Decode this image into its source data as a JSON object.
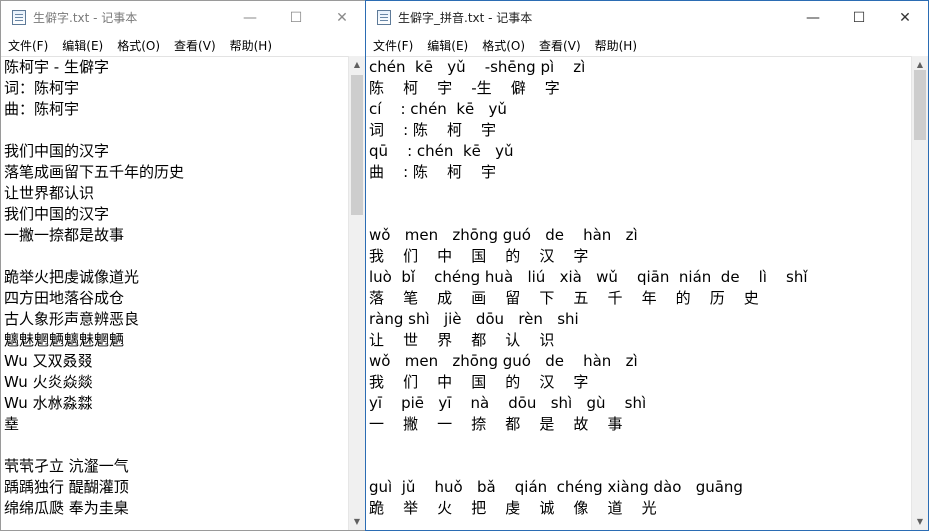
{
  "left_window": {
    "title": "生僻字.txt - 记事本",
    "controls": {
      "minimize": "—",
      "maximize": "☐",
      "close": "✕"
    },
    "menu": [
      "文件(F)",
      "编辑(E)",
      "格式(O)",
      "查看(V)",
      "帮助(H)"
    ],
    "lines": [
      "陈柯宇 - 生僻字",
      "词：陈柯宇",
      "曲：陈柯宇",
      "",
      "我们中国的汉字",
      "落笔成画留下五千年的历史",
      "让世界都认识",
      "我们中国的汉字",
      "一撇一捺都是故事",
      "",
      "跪举火把虔诚像道光",
      "四方田地落谷成仓",
      "古人象形声意辨恶良",
      "魑魅魍魉魑魅魍魉",
      "Wu 又双叒叕",
      "Wu 火炎焱燚",
      "Wu 水沝淼㵘",
      "㙓",
      "",
      "茕茕孑立 沆瀣一气",
      "踽踽独行 醍醐灌顶",
      "绵绵瓜瓞 奉为圭臬"
    ]
  },
  "right_window": {
    "title": "生僻字_拼音.txt - 记事本",
    "controls": {
      "minimize": "—",
      "maximize": "☐",
      "close": "✕"
    },
    "menu": [
      "文件(F)",
      "编辑(E)",
      "格式(O)",
      "查看(V)",
      "帮助(H)"
    ],
    "lines": [
      "chén  kē   yǔ    -shēng pì    zì",
      "陈    柯    宇    -生    僻    字",
      "cí    : chén  kē   yǔ",
      "词    : 陈    柯    宇",
      "qū    : chén  kē   yǔ",
      "曲    : 陈    柯    宇",
      "",
      "",
      "wǒ   men   zhōng guó   de    hàn   zì",
      "我    们    中    国    的    汉    字",
      "luò  bǐ    chéng huà   liú   xià   wǔ    qiān  nián  de    lì    shǐ",
      "落    笔    成    画    留    下    五    千    年    的    历    史",
      "ràng shì   jiè   dōu   rèn   shi",
      "让    世    界    都    认    识",
      "wǒ   men   zhōng guó   de    hàn   zì",
      "我    们    中    国    的    汉    字",
      "yī    piē   yī    nà    dōu   shì   gù    shì",
      "一    撇    一    捺    都    是    故    事",
      "",
      "",
      "guì  jǔ    huǒ   bǎ    qián  chéng xiàng dào   guāng",
      "跪    举    火    把    虔    诚    像    道    光"
    ]
  }
}
